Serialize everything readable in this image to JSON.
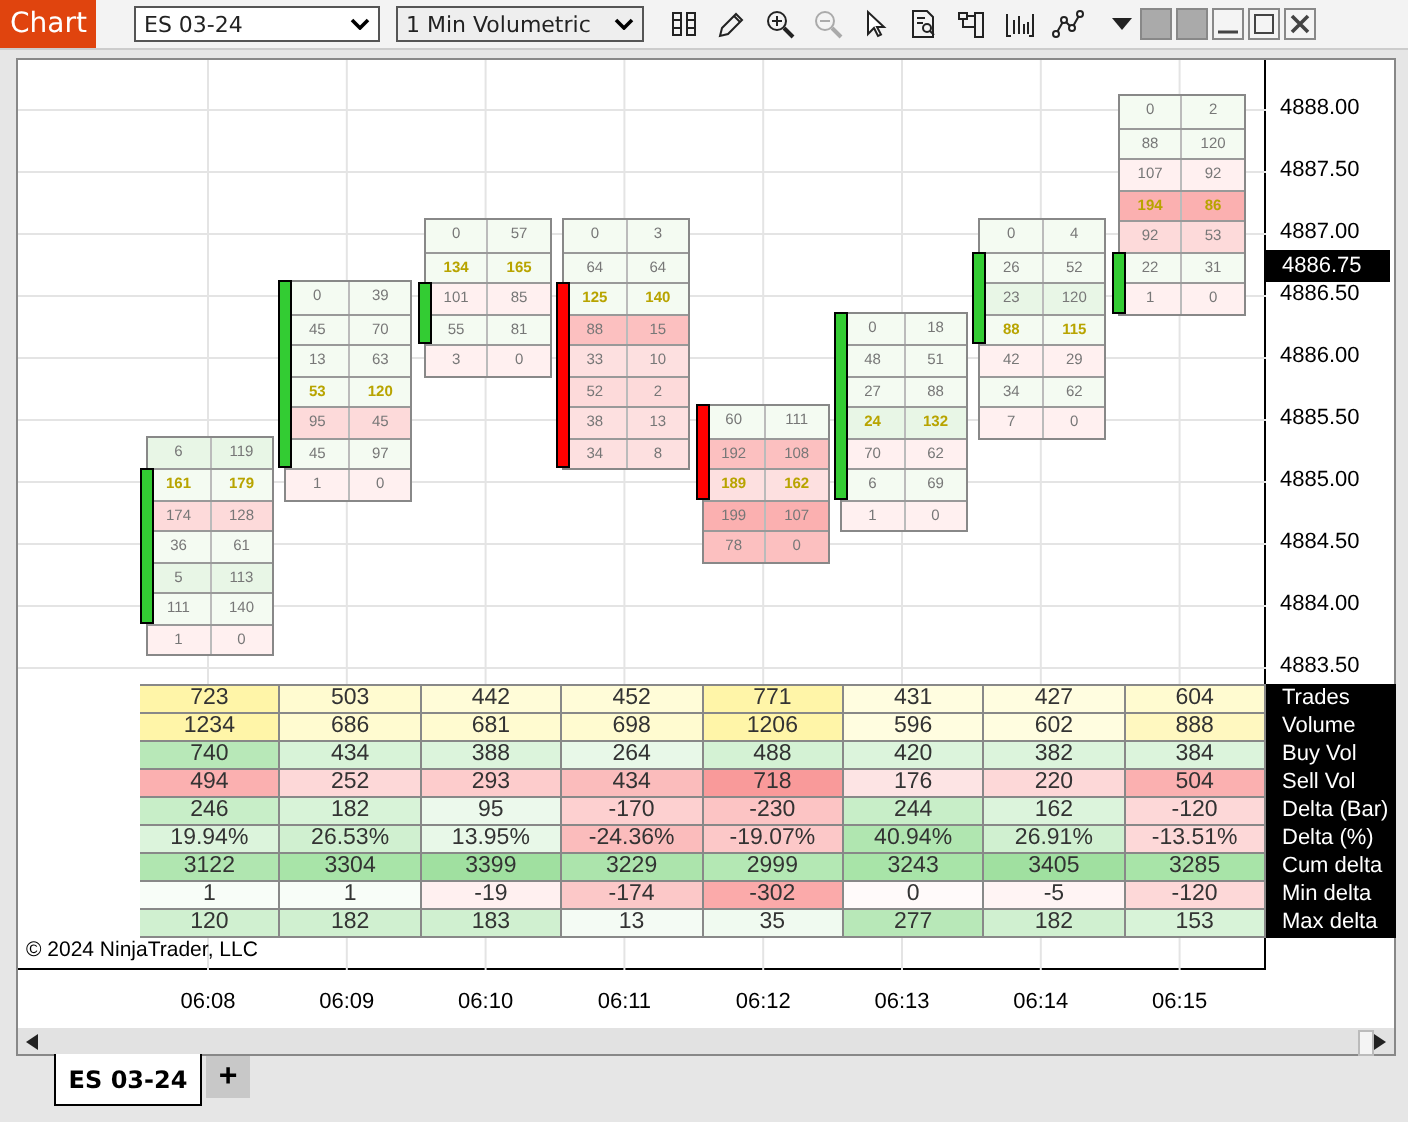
{
  "window": {
    "title": "Chart"
  },
  "toolbar": {
    "instrument": "ES 03-24",
    "interval": "1 Min Volumetric"
  },
  "price_axis": {
    "labels": [
      "4888.00",
      "4887.50",
      "4887.00",
      "4886.50",
      "4886.00",
      "4885.50",
      "4885.00",
      "4884.50",
      "4884.00",
      "4883.50"
    ],
    "current_price": "4886.75"
  },
  "bars": [
    {
      "time": "06:08",
      "bullish": true,
      "rows": [
        {
          "bid": "6",
          "ask": "119",
          "color": "#e8f6e6",
          "poc": false,
          "in_body": false
        },
        {
          "bid": "161",
          "ask": "179",
          "color": "#f4fbf2",
          "poc": true,
          "in_body": true
        },
        {
          "bid": "174",
          "ask": "128",
          "color": "#fddada",
          "poc": false,
          "in_body": true
        },
        {
          "bid": "36",
          "ask": "61",
          "color": "#f4fbf2",
          "poc": false,
          "in_body": true
        },
        {
          "bid": "5",
          "ask": "113",
          "color": "#e8f6e6",
          "poc": false,
          "in_body": true
        },
        {
          "bid": "111",
          "ask": "140",
          "color": "#f4fbf2",
          "poc": false,
          "in_body": true
        },
        {
          "bid": "1",
          "ask": "0",
          "color": "#fff0f0",
          "poc": false,
          "in_body": false
        }
      ]
    },
    {
      "time": "06:09",
      "bullish": true,
      "rows": [
        {
          "bid": "0",
          "ask": "39",
          "color": "#f4fbf2",
          "poc": false,
          "in_body": true
        },
        {
          "bid": "45",
          "ask": "70",
          "color": "#f4fbf2",
          "poc": false,
          "in_body": true
        },
        {
          "bid": "13",
          "ask": "63",
          "color": "#f4fbf2",
          "poc": false,
          "in_body": true
        },
        {
          "bid": "53",
          "ask": "120",
          "color": "#f4fbf2",
          "poc": true,
          "in_body": true
        },
        {
          "bid": "95",
          "ask": "45",
          "color": "#fddada",
          "poc": false,
          "in_body": true
        },
        {
          "bid": "45",
          "ask": "97",
          "color": "#f4fbf2",
          "poc": false,
          "in_body": true
        },
        {
          "bid": "1",
          "ask": "0",
          "color": "#fff0f0",
          "poc": false,
          "in_body": false
        }
      ]
    },
    {
      "time": "06:10",
      "bullish": true,
      "rows": [
        {
          "bid": "0",
          "ask": "57",
          "color": "#f4fbf2",
          "poc": false,
          "in_body": false
        },
        {
          "bid": "134",
          "ask": "165",
          "color": "#f4fbf2",
          "poc": true,
          "in_body": false
        },
        {
          "bid": "101",
          "ask": "85",
          "color": "#fff0f0",
          "poc": false,
          "in_body": true
        },
        {
          "bid": "55",
          "ask": "81",
          "color": "#f4fbf2",
          "poc": false,
          "in_body": true
        },
        {
          "bid": "3",
          "ask": "0",
          "color": "#fff0f0",
          "poc": false,
          "in_body": false
        }
      ]
    },
    {
      "time": "06:11",
      "bullish": false,
      "rows": [
        {
          "bid": "0",
          "ask": "3",
          "color": "#f4fbf2",
          "poc": false,
          "in_body": false
        },
        {
          "bid": "64",
          "ask": "64",
          "color": "#f4fbf2",
          "poc": false,
          "in_body": false
        },
        {
          "bid": "125",
          "ask": "140",
          "color": "#f4fbf2",
          "poc": true,
          "in_body": true
        },
        {
          "bid": "88",
          "ask": "15",
          "color": "#fcc0c0",
          "poc": false,
          "in_body": true
        },
        {
          "bid": "33",
          "ask": "10",
          "color": "#fde0e0",
          "poc": false,
          "in_body": true
        },
        {
          "bid": "52",
          "ask": "2",
          "color": "#fddada",
          "poc": false,
          "in_body": true
        },
        {
          "bid": "38",
          "ask": "13",
          "color": "#fde0e0",
          "poc": false,
          "in_body": true
        },
        {
          "bid": "34",
          "ask": "8",
          "color": "#fde0e0",
          "poc": false,
          "in_body": true
        }
      ]
    },
    {
      "time": "06:12",
      "bullish": false,
      "rows": [
        {
          "bid": "60",
          "ask": "111",
          "color": "#f4fbf2",
          "poc": false,
          "in_body": true
        },
        {
          "bid": "192",
          "ask": "108",
          "color": "#fcc0c0",
          "poc": false,
          "in_body": true
        },
        {
          "bid": "189",
          "ask": "162",
          "color": "#fde0e0",
          "poc": true,
          "in_body": true
        },
        {
          "bid": "199",
          "ask": "107",
          "color": "#fbb0b0",
          "poc": false,
          "in_body": false
        },
        {
          "bid": "78",
          "ask": "0",
          "color": "#fcc0c0",
          "poc": false,
          "in_body": false
        }
      ]
    },
    {
      "time": "06:13",
      "bullish": true,
      "rows": [
        {
          "bid": "0",
          "ask": "18",
          "color": "#f4fbf2",
          "poc": false,
          "in_body": true
        },
        {
          "bid": "48",
          "ask": "51",
          "color": "#f4fbf2",
          "poc": false,
          "in_body": true
        },
        {
          "bid": "27",
          "ask": "88",
          "color": "#f4fbf2",
          "poc": false,
          "in_body": true
        },
        {
          "bid": "24",
          "ask": "132",
          "color": "#e8f6e6",
          "poc": true,
          "in_body": true
        },
        {
          "bid": "70",
          "ask": "62",
          "color": "#fff0f0",
          "poc": false,
          "in_body": true
        },
        {
          "bid": "6",
          "ask": "69",
          "color": "#f4fbf2",
          "poc": false,
          "in_body": true
        },
        {
          "bid": "1",
          "ask": "0",
          "color": "#fff0f0",
          "poc": false,
          "in_body": false
        }
      ]
    },
    {
      "time": "06:14",
      "bullish": true,
      "rows": [
        {
          "bid": "0",
          "ask": "4",
          "color": "#f4fbf2",
          "poc": false,
          "in_body": false
        },
        {
          "bid": "26",
          "ask": "52",
          "color": "#f4fbf2",
          "poc": false,
          "in_body": true
        },
        {
          "bid": "23",
          "ask": "120",
          "color": "#e8f6e6",
          "poc": false,
          "in_body": true
        },
        {
          "bid": "88",
          "ask": "115",
          "color": "#f4fbf2",
          "poc": true,
          "in_body": true
        },
        {
          "bid": "42",
          "ask": "29",
          "color": "#fff0f0",
          "poc": false,
          "in_body": false
        },
        {
          "bid": "34",
          "ask": "62",
          "color": "#f4fbf2",
          "poc": false,
          "in_body": false
        },
        {
          "bid": "7",
          "ask": "0",
          "color": "#fff0f0",
          "poc": false,
          "in_body": false
        }
      ]
    },
    {
      "time": "06:15",
      "bullish": true,
      "rows": [
        {
          "bid": "0",
          "ask": "2",
          "color": "#f4fbf2",
          "poc": false,
          "in_body": false
        },
        {
          "bid": "88",
          "ask": "120",
          "color": "#f4fbf2",
          "poc": false,
          "in_body": false
        },
        {
          "bid": "107",
          "ask": "92",
          "color": "#fff0f0",
          "poc": false,
          "in_body": false
        },
        {
          "bid": "194",
          "ask": "86",
          "color": "#fbb0b0",
          "poc": true,
          "in_body": false
        },
        {
          "bid": "92",
          "ask": "53",
          "color": "#fddada",
          "poc": false,
          "in_body": false
        },
        {
          "bid": "22",
          "ask": "31",
          "color": "#f4fbf2",
          "poc": false,
          "in_body": true
        },
        {
          "bid": "1",
          "ask": "0",
          "color": "#fff0f0",
          "poc": false,
          "in_body": true
        }
      ]
    }
  ],
  "summary_table": {
    "rows": [
      {
        "label": "Trades",
        "cells": [
          {
            "value": "723",
            "color": "#fff5a8"
          },
          {
            "value": "503",
            "color": "#fffbd0"
          },
          {
            "value": "442",
            "color": "#fffcd8"
          },
          {
            "value": "452",
            "color": "#fffcd8"
          },
          {
            "value": "771",
            "color": "#fff5a8"
          },
          {
            "value": "431",
            "color": "#fffde0"
          },
          {
            "value": "427",
            "color": "#fffde0"
          },
          {
            "value": "604",
            "color": "#fffbd0"
          }
        ]
      },
      {
        "label": "Volume",
        "cells": [
          {
            "value": "1234",
            "color": "#fff5a8"
          },
          {
            "value": "686",
            "color": "#fffbd0"
          },
          {
            "value": "681",
            "color": "#fffbd0"
          },
          {
            "value": "698",
            "color": "#fffbd0"
          },
          {
            "value": "1206",
            "color": "#fff5a8"
          },
          {
            "value": "596",
            "color": "#fffde0"
          },
          {
            "value": "602",
            "color": "#fffde0"
          },
          {
            "value": "888",
            "color": "#fff8c0"
          }
        ]
      },
      {
        "label": "Buy Vol",
        "cells": [
          {
            "value": "740",
            "color": "#b8e8b8"
          },
          {
            "value": "434",
            "color": "#d8f3d8"
          },
          {
            "value": "388",
            "color": "#dcf4dc"
          },
          {
            "value": "264",
            "color": "#e8f8e8"
          },
          {
            "value": "488",
            "color": "#d4f2d4"
          },
          {
            "value": "420",
            "color": "#dcf4dc"
          },
          {
            "value": "382",
            "color": "#dcf4dc"
          },
          {
            "value": "384",
            "color": "#dcf4dc"
          }
        ]
      },
      {
        "label": "Sell Vol",
        "cells": [
          {
            "value": "494",
            "color": "#fbb0b0"
          },
          {
            "value": "252",
            "color": "#fdd8d8"
          },
          {
            "value": "293",
            "color": "#fdcccc"
          },
          {
            "value": "434",
            "color": "#fbbcbc"
          },
          {
            "value": "718",
            "color": "#f99a9a"
          },
          {
            "value": "176",
            "color": "#fde4e4"
          },
          {
            "value": "220",
            "color": "#fdd8d8"
          },
          {
            "value": "504",
            "color": "#fbb0b0"
          }
        ]
      },
      {
        "label": "Delta (Bar)",
        "cells": [
          {
            "value": "246",
            "color": "#c8eec8"
          },
          {
            "value": "182",
            "color": "#d8f3d8"
          },
          {
            "value": "95",
            "color": "#ecf9ec"
          },
          {
            "value": "-170",
            "color": "#fdd0d0"
          },
          {
            "value": "-230",
            "color": "#fcc4c4"
          },
          {
            "value": "244",
            "color": "#c8eec8"
          },
          {
            "value": "162",
            "color": "#dcf4dc"
          },
          {
            "value": "-120",
            "color": "#fdd8d8"
          }
        ]
      },
      {
        "label": "Delta (%)",
        "cells": [
          {
            "value": "19.94%",
            "color": "#dcf4dc"
          },
          {
            "value": "26.53%",
            "color": "#d0f0d0"
          },
          {
            "value": "13.95%",
            "color": "#e8f8e8"
          },
          {
            "value": "-24.36%",
            "color": "#fbbcbc"
          },
          {
            "value": "-19.07%",
            "color": "#fcc8c8"
          },
          {
            "value": "40.94%",
            "color": "#b0e6b0"
          },
          {
            "value": "26.91%",
            "color": "#d0f0d0"
          },
          {
            "value": "-13.51%",
            "color": "#fdd8d8"
          }
        ]
      },
      {
        "label": "Cum delta",
        "cells": [
          {
            "value": "3122",
            "color": "#b0e6b0"
          },
          {
            "value": "3304",
            "color": "#a8e4a8"
          },
          {
            "value": "3399",
            "color": "#a0e0a0"
          },
          {
            "value": "3229",
            "color": "#ace4ac"
          },
          {
            "value": "2999",
            "color": "#b4e8b4"
          },
          {
            "value": "3243",
            "color": "#a8e4a8"
          },
          {
            "value": "3405",
            "color": "#a0e0a0"
          },
          {
            "value": "3285",
            "color": "#a8e4a8"
          }
        ]
      },
      {
        "label": "Min delta",
        "cells": [
          {
            "value": "1",
            "color": "#f8fdf8"
          },
          {
            "value": "1",
            "color": "#f8fdf8"
          },
          {
            "value": "-19",
            "color": "#fff0f0"
          },
          {
            "value": "-174",
            "color": "#fcc8c8"
          },
          {
            "value": "-302",
            "color": "#fbaaaa"
          },
          {
            "value": "0",
            "color": "#fffafa"
          },
          {
            "value": "-5",
            "color": "#fff4f4"
          },
          {
            "value": "-120",
            "color": "#fdd8d8"
          }
        ]
      },
      {
        "label": "Max delta",
        "cells": [
          {
            "value": "120",
            "color": "#d0f0d0"
          },
          {
            "value": "182",
            "color": "#d0f0d0"
          },
          {
            "value": "183",
            "color": "#d0f0d0"
          },
          {
            "value": "13",
            "color": "#f4fbf4"
          },
          {
            "value": "35",
            "color": "#f0faf0"
          },
          {
            "value": "277",
            "color": "#b8e8b8"
          },
          {
            "value": "182",
            "color": "#d0f0d0"
          },
          {
            "value": "153",
            "color": "#d8f3d8"
          }
        ]
      }
    ]
  },
  "copyright": "© 2024 NinjaTrader, LLC",
  "tabs": [
    {
      "label": "ES 03-24",
      "selected": true
    }
  ],
  "add_tab": "+"
}
